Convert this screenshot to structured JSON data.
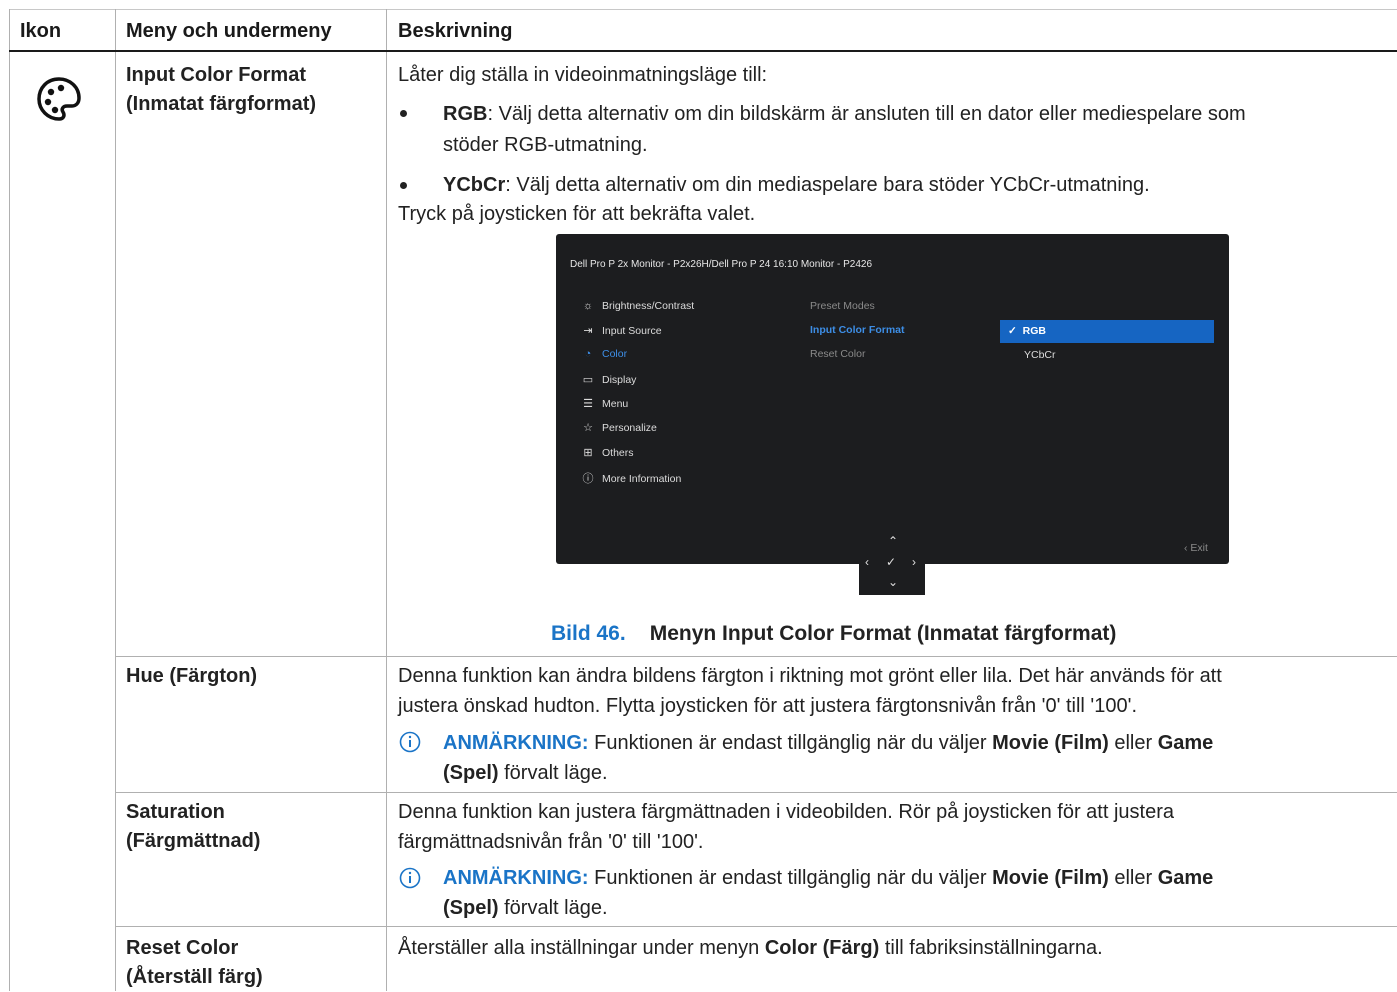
{
  "header": {
    "col_icon": "Ikon",
    "col_menu": "Meny och undermeny",
    "col_desc": "Beskrivning"
  },
  "rows": {
    "input_color_format": {
      "name_line1": "Input Color Format",
      "name_line2": "(Inmatat färgformat)",
      "intro": "Låter dig ställa in videoinmatningsläge till:",
      "bullet1_bold": "RGB",
      "bullet1_line1": ": Välj detta alternativ om din bildskärm är ansluten till en dator eller mediespelare som",
      "bullet1_line2": "stöder RGB-utmatning.",
      "bullet2_bold": "YCbCr",
      "bullet2_text": ": Välj detta alternativ om din mediaspelare bara stöder YCbCr-utmatning.",
      "outro": "Tryck på joysticken för att bekräfta valet.",
      "caption_num": "Bild 46.",
      "caption_text": "Menyn Input Color Format (Inmatat färgformat)"
    },
    "hue": {
      "name": "Hue (Färgton)",
      "line1": "Denna funktion kan ändra bildens färgton i riktning mot grönt eller lila. Det här används för att",
      "line2": "justera önskad hudton. Flytta joysticken för att justera färgtonsnivån från '0' till '100'.",
      "note_label": "ANMÄRKNING:",
      "note_text1": " Funktionen är endast tillgänglig när du väljer ",
      "note_bold1": "Movie (Film)",
      "note_text2": " eller ",
      "note_bold2": "Game",
      "note_bold3": "(Spel)",
      "note_text3": " förvalt läge."
    },
    "saturation": {
      "name_line1": "Saturation",
      "name_line2": "(Färgmättnad)",
      "line1": "Denna funktion kan justera färgmättnaden i videobilden. Rör på joysticken för att justera",
      "line2": "färgmättnadsnivån från '0' till '100'.",
      "note_label": "ANMÄRKNING:",
      "note_text1": " Funktionen är endast tillgänglig när du väljer ",
      "note_bold1": "Movie (Film)",
      "note_text2": " eller ",
      "note_bold2": "Game",
      "note_bold3": "(Spel)",
      "note_text3": " förvalt läge."
    },
    "reset_color": {
      "name_line1": "Reset Color",
      "name_line2": "(Återställ färg)",
      "text1": "Återställer alla inställningar under menyn ",
      "text_bold": "Color (Färg)",
      "text2": " till fabriksinställningarna."
    }
  },
  "osd": {
    "title": "Dell Pro P 2x Monitor - P2x26H/Dell Pro P 24 16:10 Monitor - P2426",
    "menu": [
      "Brightness/Contrast",
      "Input Source",
      "Color",
      "Display",
      "Menu",
      "Personalize",
      "Others",
      "More Information"
    ],
    "submenu": [
      "Preset Modes",
      "Input Color Format",
      "Reset Color"
    ],
    "options": [
      "RGB",
      "YCbCr"
    ],
    "exit": "Exit",
    "accent_color": "#1665c2",
    "active_menu": "Color",
    "active_submenu": "Input Color Format",
    "selected_option": "RGB"
  },
  "colors": {
    "note_blue": "#1a74c7"
  }
}
